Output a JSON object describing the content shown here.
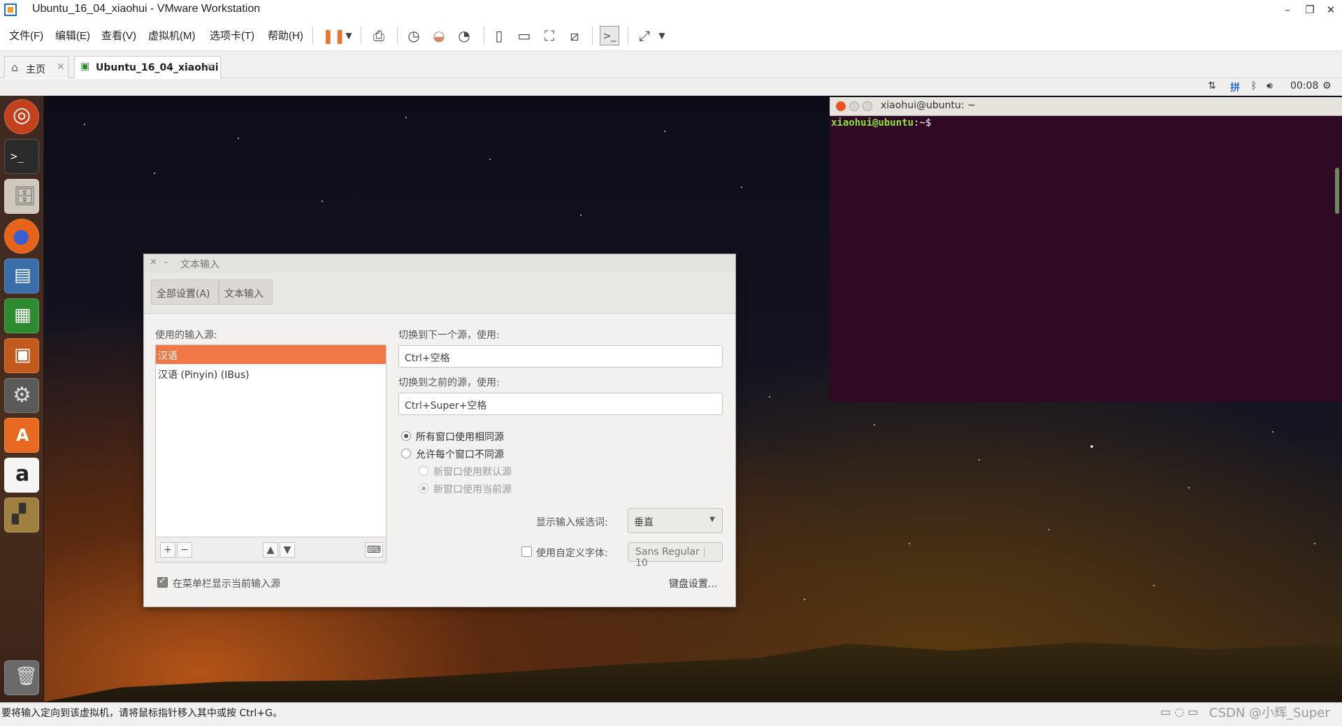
{
  "app": {
    "title": "Ubuntu_16_04_xiaohui - VMware Workstation",
    "window_controls": {
      "minimize": "–",
      "restore": "❐",
      "close": "✕"
    }
  },
  "menubar": [
    "文件(F)",
    "编辑(E)",
    "查看(V)",
    "虚拟机(M)",
    "选项卡(T)",
    "帮助(H)"
  ],
  "tabs": [
    {
      "label": "主页",
      "icon": "home-icon"
    },
    {
      "label": "Ubuntu_16_04_xiaohui",
      "icon": "vm-icon"
    }
  ],
  "guest_tray": {
    "time": "00:08"
  },
  "terminal": {
    "title": "xiaohui@ubuntu: ~",
    "prompt_user": "xiaohui@ubuntu",
    "prompt_suffix": ":~$"
  },
  "dialog": {
    "title": "文本输入",
    "breadcrumb": [
      "全部设置(A)",
      "文本输入"
    ],
    "sources_label": "使用的输入源:",
    "sources": [
      "汉语",
      "汉语 (Pinyin) (IBus)"
    ],
    "next_source_label": "切换到下一个源，使用:",
    "next_source_value": "Ctrl+空格",
    "prev_source_label": "切换到之前的源，使用:",
    "prev_source_value": "Ctrl+Super+空格",
    "radio_same": "所有窗口使用相同源",
    "radio_different": "允许每个窗口不同源",
    "radio_default": "新窗口使用默认源",
    "radio_current": "新窗口使用当前源",
    "candidates_label": "显示输入候选词:",
    "candidates_value": "垂直",
    "custom_font_label": "使用自定义字体:",
    "font_name": "Sans Regular",
    "font_size": "10",
    "show_in_menubar": "在菜单栏显示当前输入源",
    "keyboard_settings": "键盘设置..."
  },
  "statusbar": {
    "text": "要将输入定向到该虚拟机，请将鼠标指针移入其中或按 Ctrl+G。",
    "watermark": "CSDN @小辉_Super"
  },
  "colors": {
    "selection": "#f07746",
    "terminal_bg": "#300a24",
    "prompt_green": "#8ae234"
  }
}
